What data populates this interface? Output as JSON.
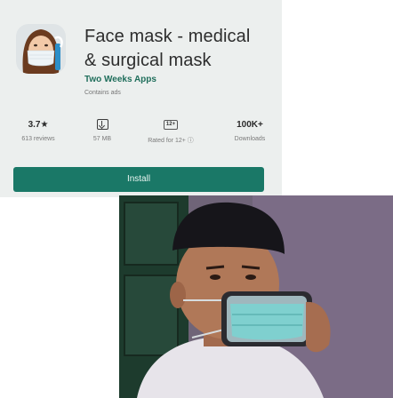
{
  "app": {
    "title_line1": "Face mask - medical",
    "title_line2": "& surgical mask",
    "developer": "Two Weeks Apps",
    "contains_ads": "Contains ads",
    "icon": "face-mask-woman-icon"
  },
  "stats": {
    "rating": {
      "value": "3.7★",
      "label": "613 reviews"
    },
    "size": {
      "icon": "download-icon",
      "label": "57 MB"
    },
    "age": {
      "badge": "12+",
      "label": "Rated for 12+",
      "info": "ⓘ"
    },
    "downloads": {
      "value": "100K+",
      "label": "Downloads"
    }
  },
  "install": {
    "label": "Install"
  },
  "colors": {
    "accent": "#1a7867",
    "developer": "#1f6e5b",
    "card_bg": "#ecefee"
  },
  "photo": {
    "subject": "man-holding-phone-with-mask-image",
    "icon": "man-wearing-phone-mask-photo"
  }
}
